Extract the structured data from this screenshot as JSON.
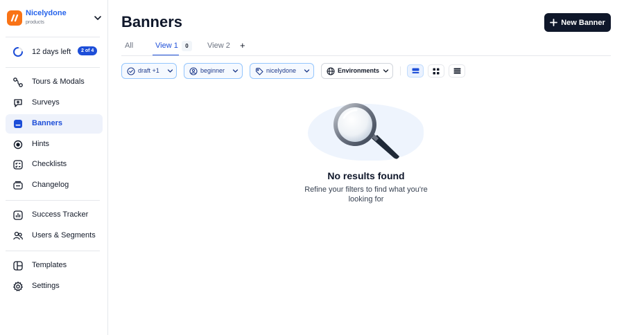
{
  "workspace": {
    "name": "Nicelydone",
    "subtitle": "products"
  },
  "trial": {
    "days_left": "12 days left",
    "progress_badge": "2 of 4"
  },
  "sidebar": {
    "items": [
      {
        "label": "Tours & Modals",
        "icon": "tours-icon"
      },
      {
        "label": "Surveys",
        "icon": "surveys-icon"
      },
      {
        "label": "Banners",
        "icon": "banners-icon",
        "active": true
      },
      {
        "label": "Hints",
        "icon": "hints-icon"
      },
      {
        "label": "Checklists",
        "icon": "checklists-icon"
      },
      {
        "label": "Changelog",
        "icon": "changelog-icon"
      },
      {
        "label": "Success Tracker",
        "icon": "success-tracker-icon"
      },
      {
        "label": "Users & Segments",
        "icon": "users-icon"
      },
      {
        "label": "Templates",
        "icon": "templates-icon"
      },
      {
        "label": "Settings",
        "icon": "settings-icon"
      }
    ]
  },
  "header": {
    "title": "Banners",
    "new_button": "New Banner"
  },
  "tabs": {
    "items": [
      {
        "label": "All"
      },
      {
        "label": "View 1",
        "count": "0",
        "active": true
      },
      {
        "label": "View 2"
      }
    ],
    "add_label": "+"
  },
  "filters": {
    "status": "draft +1",
    "level": "beginner",
    "tag": "nicelydone",
    "environments": "Environments"
  },
  "empty_state": {
    "title": "No results found",
    "description": "Refine your filters to find what you're looking for"
  },
  "colors": {
    "accent": "#1d4ed8",
    "primary_button": "#0f172a",
    "logo": "#f97316"
  }
}
